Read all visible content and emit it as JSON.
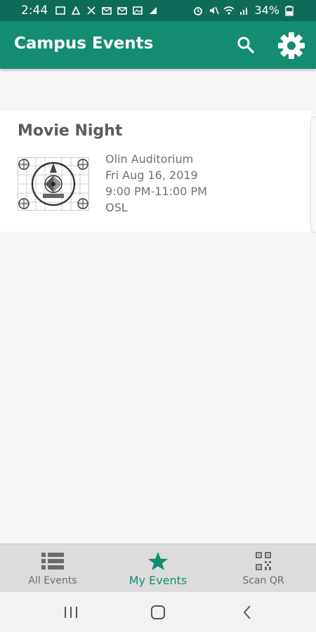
{
  "status_bar": {
    "time": "2:44",
    "battery": "34%"
  },
  "app_bar": {
    "title": "Campus Events",
    "icons": [
      "search-icon",
      "gear-icon"
    ]
  },
  "event": {
    "title": "Movie Night",
    "location": "Olin Auditorium",
    "date": "Fri Aug 16, 2019",
    "time": "9:00 PM-11:00 PM",
    "organizer": "OSL",
    "thumbnail": "test-pattern-image"
  },
  "bottom_nav": {
    "items": [
      {
        "label": "All Events",
        "icon": "list-icon"
      },
      {
        "label": "My Events",
        "icon": "star-icon",
        "active": true
      },
      {
        "label": "Scan QR",
        "icon": "qr-code-icon"
      }
    ]
  },
  "colors": {
    "status_bar": "#0d6b57",
    "app_bar": "#138c72",
    "accent": "#138c72",
    "background": "#f7f7f7",
    "nav_background": "#dcdcdc"
  }
}
